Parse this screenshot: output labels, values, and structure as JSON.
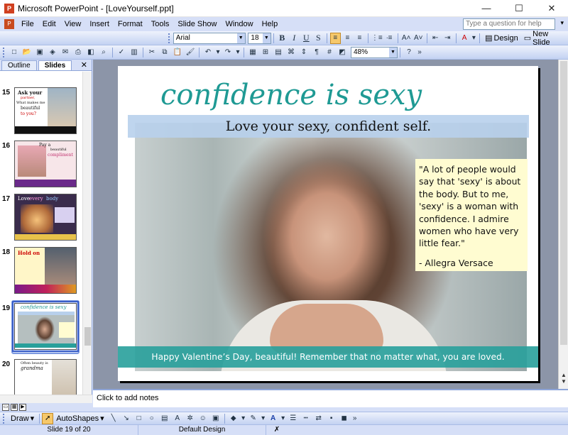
{
  "window": {
    "title": "Microsoft PowerPoint - [LoveYourself.ppt]",
    "controls": [
      "—",
      "☐",
      "✕"
    ]
  },
  "menu": {
    "items": [
      "File",
      "Edit",
      "View",
      "Insert",
      "Format",
      "Tools",
      "Slide Show",
      "Window",
      "Help"
    ],
    "ask_placeholder": "Type a question for help"
  },
  "formatting": {
    "font": "Arial",
    "size": "18",
    "bold": "B",
    "italic": "I",
    "underline": "U",
    "shadow": "S",
    "design_label": "Design",
    "new_slide_label": "New Slide"
  },
  "standard": {
    "zoom": "48%"
  },
  "pane": {
    "tab_outline": "Outline",
    "tab_slides": "Slides",
    "close": "✕",
    "thumbnails": [
      {
        "number": "15",
        "line1": "Ask your",
        "line2": "partner,",
        "line3": "What makes me",
        "line4": "beautiful",
        "line5": "to you?"
      },
      {
        "number": "16",
        "line1": "Pay a",
        "line2": "beautiful",
        "line3": "compliment"
      },
      {
        "number": "17",
        "line1": "Love",
        "line2": "every",
        "line3": "body"
      },
      {
        "number": "18",
        "line1": "Hold on"
      },
      {
        "number": "19",
        "line1": "confidence is sexy"
      },
      {
        "number": "20",
        "line1": "Often beauty is",
        "line2": "grandma"
      }
    ]
  },
  "slide": {
    "title": "confidence is sexy",
    "subtitle": "Love your sexy, confident self.",
    "quote": "\"A lot of people would say that 'sexy' is about the body. But to me, 'sexy' is a woman with confidence. I admire women who have very little fear.\"",
    "quote_author": "- Allegra Versace",
    "banner": "Happy Valentine’s Day, beautiful! Remember that no matter what, you are loved."
  },
  "notes": {
    "placeholder": "Click to add notes"
  },
  "draw": {
    "draw_label": "Draw",
    "autoshapes_label": "AutoShapes"
  },
  "status": {
    "slide_position": "Slide 19 of 20",
    "design": "Default Design"
  },
  "colors": {
    "title_teal": "#1f9a94",
    "banner_teal": "#28a09b",
    "quote_bg": "#fffcd1",
    "chrome_blue": "#d6dff7"
  }
}
